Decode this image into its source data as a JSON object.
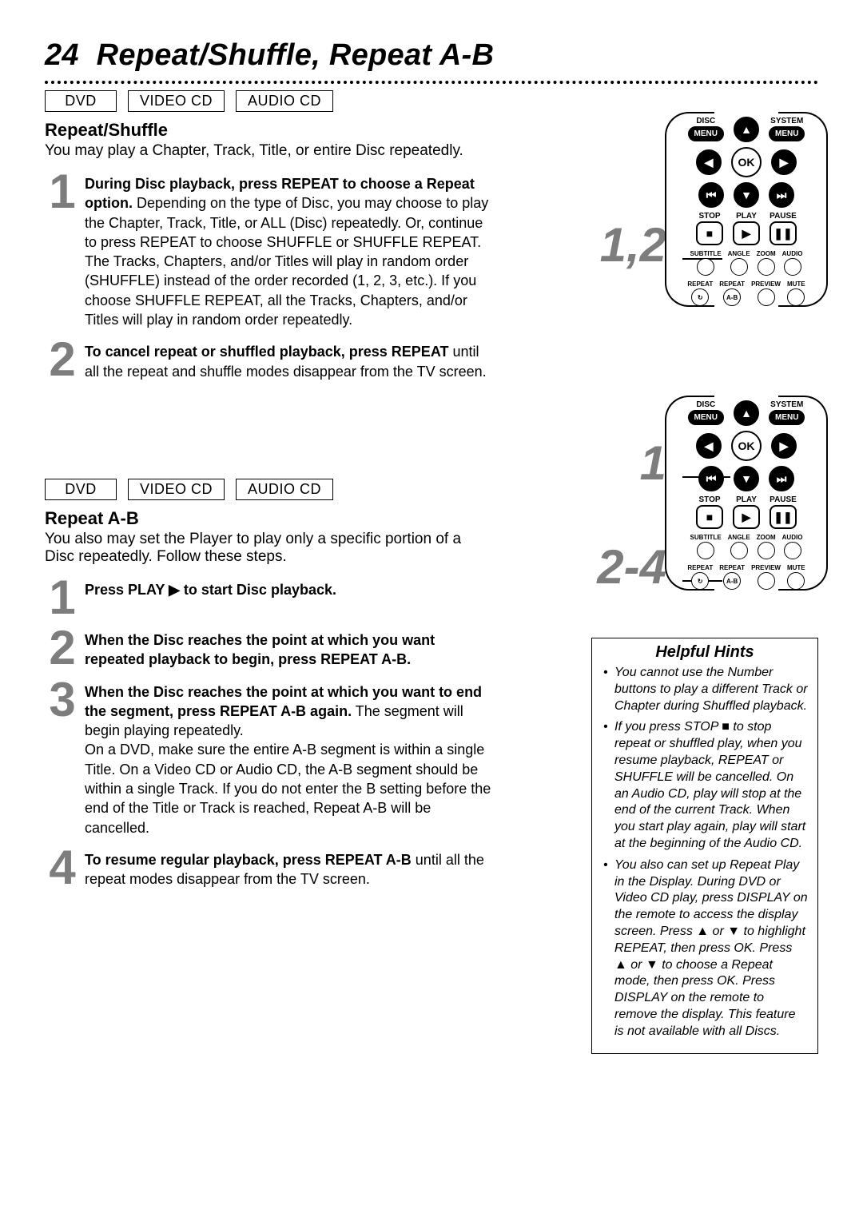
{
  "page_number": "24",
  "page_title": "Repeat/Shuffle, Repeat A-B",
  "formats": [
    "DVD",
    "VIDEO CD",
    "AUDIO CD"
  ],
  "section1": {
    "heading": "Repeat/Shuffle",
    "intro": "You may play a Chapter, Track, Title, or entire Disc repeatedly.",
    "remote_tag": "1,2",
    "steps": [
      {
        "num": "1",
        "lead": "During Disc playback, press REPEAT to choose a Repeat option.",
        "rest": " Depending on the type of Disc, you may choose to play the Chapter,  Track,  Title, or ALL (Disc) repeatedly. Or, continue to press REPEAT to choose SHUFFLE or SHUFFLE REPEAT. The Tracks, Chapters, and/or Titles will play in random order (SHUFFLE) instead of the order recorded (1, 2, 3, etc.). If you choose SHUFFLE REPEAT, all the Tracks, Chapters, and/or Titles will play in random order repeatedly."
      },
      {
        "num": "2",
        "lead": "To cancel repeat or shuffled playback, press REPEAT",
        "rest": " until all the repeat and shuffle modes disappear from the TV screen."
      }
    ]
  },
  "section2": {
    "heading": "Repeat A-B",
    "intro": "You also may set the Player to play only a specific portion of a Disc repeatedly. Follow these steps.",
    "remote_tag_a": "1",
    "remote_tag_b": "2-4",
    "steps": [
      {
        "num": "1",
        "lead": "Press PLAY ▶ to start Disc playback.",
        "rest": ""
      },
      {
        "num": "2",
        "lead": "When the Disc reaches the point at which you want repeated playback to begin, press REPEAT A-B.",
        "rest": ""
      },
      {
        "num": "3",
        "lead": "When the Disc reaches the point at which you want to end the segment, press REPEAT A-B again.",
        "rest": " The segment will begin playing repeatedly.\nOn a DVD, make sure the entire A-B segment is within a single Title. On a Video CD or Audio CD, the A-B segment should be within a single Track. If you do not enter the B setting before the end of the Title or Track is reached, Repeat A-B will be cancelled."
      },
      {
        "num": "4",
        "lead": "To resume regular playback, press REPEAT A-B",
        "rest": " until all the repeat modes disappear from the TV screen."
      }
    ]
  },
  "remote_labels": {
    "disc": "DISC",
    "system": "SYSTEM",
    "menu": "MENU",
    "ok": "OK",
    "stop": "STOP",
    "play": "PLAY",
    "pause": "PAUSE",
    "subtitle": "SUBTITLE",
    "angle": "ANGLE",
    "zoom": "ZOOM",
    "audio": "AUDIO",
    "repeat": "REPEAT",
    "repeat_ab": "REPEAT",
    "ab": "A-B",
    "preview": "PREVIEW",
    "mute": "MUTE"
  },
  "hints": {
    "title": "Helpful Hints",
    "items": [
      "You cannot use the Number buttons to play a different Track or Chapter during Shuffled playback.",
      "If you press STOP ■ to stop repeat or shuffled play, when you resume playback, REPEAT or SHUFFLE will be cancelled. On an Audio CD, play will stop at the end of the current Track. When you start play again, play will start at the beginning of the Audio CD.",
      "You also can set up Repeat Play in the Display. During DVD or Video CD play, press DISPLAY on the remote to access the display screen. Press ▲ or ▼  to highlight REPEAT, then press OK. Press ▲ or ▼ to choose a Repeat mode, then press OK. Press DISPLAY on the remote to remove the display. This feature is not available with all Discs."
    ]
  }
}
